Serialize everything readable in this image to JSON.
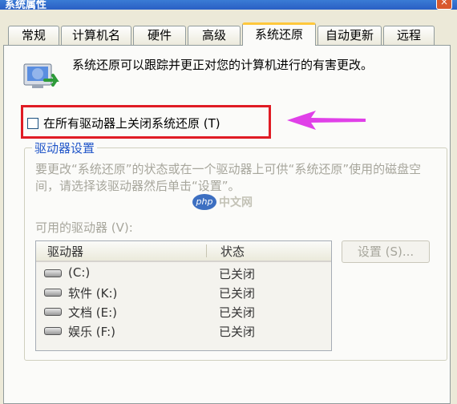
{
  "window": {
    "title": "系统属性",
    "close_glyph": "×"
  },
  "tabs": [
    "常规",
    "计算机名",
    "硬件",
    "高级",
    "系统还原",
    "自动更新",
    "远程"
  ],
  "active_tab": "系统还原",
  "intro_text": "系统还原可以跟踪并更正对您的计算机进行的有害更改。",
  "disable_checkbox": {
    "label": "在所有驱动器上关闭系统还原 (T)",
    "checked": false
  },
  "drive_settings": {
    "title": "驱动器设置",
    "description": "要更改“系统还原”的状态或在一个驱动器上可供“系统还原”使用的磁盘空间，请选择该驱动器然后单击“设置”。",
    "available_label": "可用的驱动器 (V):",
    "columns": {
      "drive": "驱动器",
      "status": "状态"
    },
    "drives": [
      {
        "name": "(C:)",
        "status": "已关闭"
      },
      {
        "name": "软件 (K:)",
        "status": "已关闭"
      },
      {
        "name": "文档 (E:)",
        "status": "已关闭"
      },
      {
        "name": "娱乐 (F:)",
        "status": "已关闭"
      }
    ],
    "settings_button": "设置 (S)..."
  },
  "watermark": {
    "logo": "php",
    "text": "中文网"
  },
  "colors": {
    "highlight": "#e01b24",
    "arrow": "#e040e8",
    "group_title": "#2156c9"
  }
}
